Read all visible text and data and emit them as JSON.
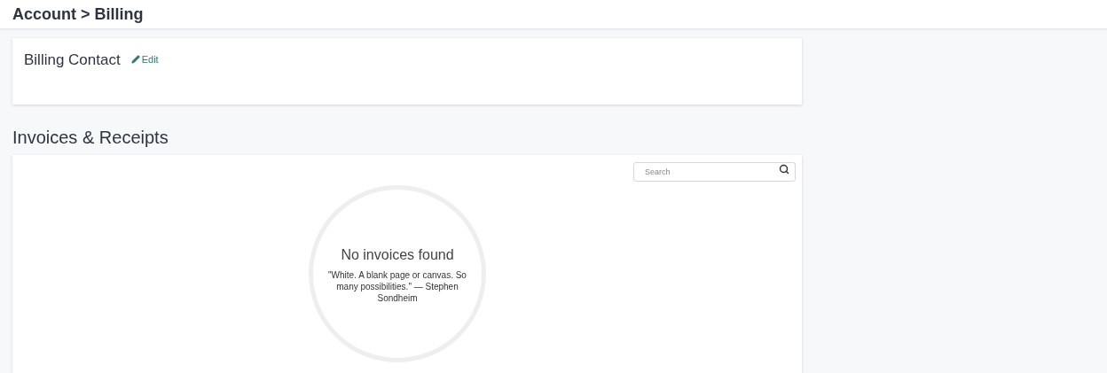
{
  "header": {
    "title": "Account > Billing"
  },
  "billing_contact": {
    "title": "Billing Contact",
    "edit_link": "Edit"
  },
  "invoices": {
    "title": "Invoices & Receipts",
    "search": {
      "placeholder": "Search"
    },
    "empty_state": {
      "title": "No invoices found",
      "quote": "\"White. A blank page or canvas. So many possibilities.\" — Stephen Sondheim"
    }
  }
}
